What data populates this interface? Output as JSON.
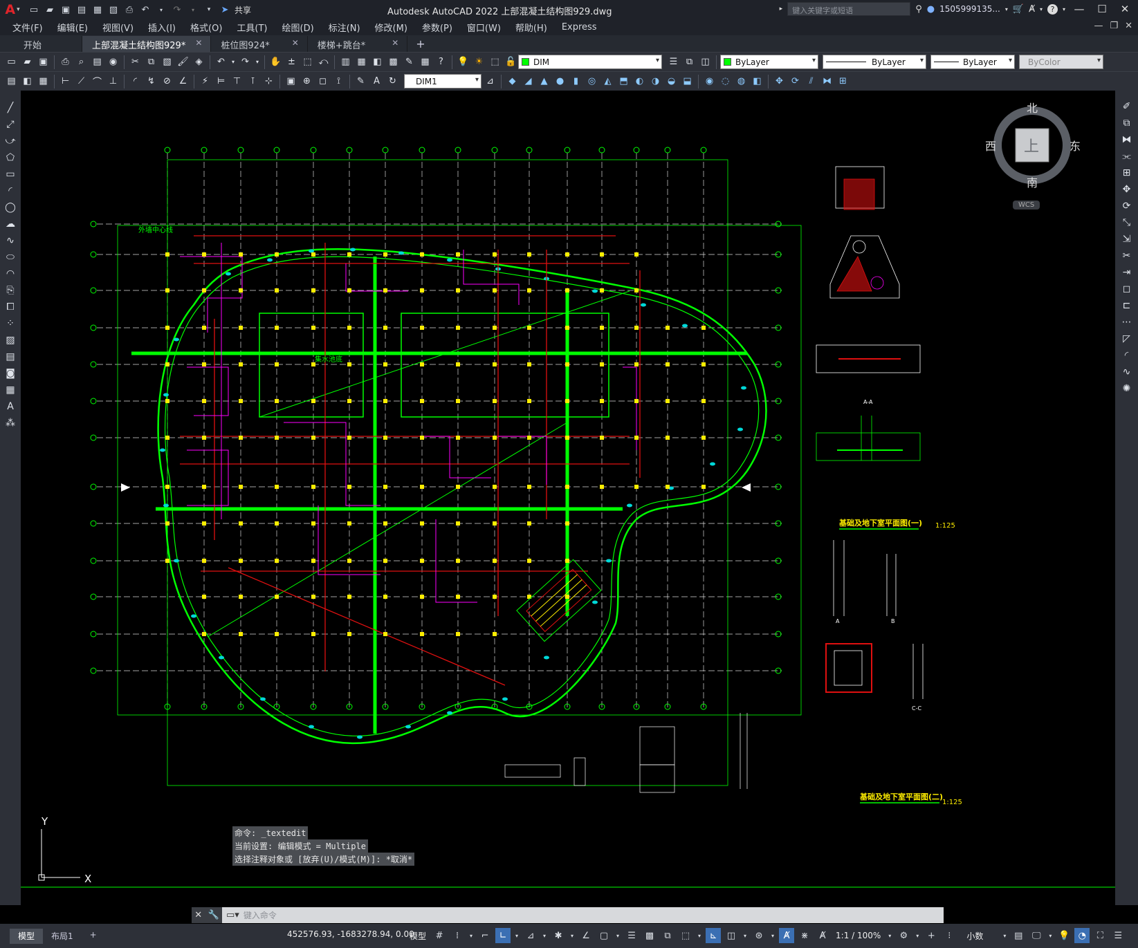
{
  "app": {
    "logo": "A",
    "title": "Autodesk AutoCAD 2022    上部混凝土结构图929.dwg",
    "share_label": "共享",
    "search_placeholder": "键入关键字或短语",
    "user": "1505999135...",
    "help": "?"
  },
  "menu": [
    "文件(F)",
    "编辑(E)",
    "视图(V)",
    "插入(I)",
    "格式(O)",
    "工具(T)",
    "绘图(D)",
    "标注(N)",
    "修改(M)",
    "参数(P)",
    "窗口(W)",
    "帮助(H)",
    "Express"
  ],
  "tabs": [
    {
      "label": "开始",
      "active": false,
      "closable": false
    },
    {
      "label": "上部混凝土结构图929*",
      "active": true,
      "closable": true
    },
    {
      "label": "桩位图924*",
      "active": false,
      "closable": true
    },
    {
      "label": "楼梯+跳台*",
      "active": false,
      "closable": true
    }
  ],
  "toolbar": {
    "layer": "DIM",
    "color": "ByLayer",
    "linetype": "ByLayer",
    "lineweight": "ByLayer",
    "plotstyle": "ByColor",
    "dimstyle": "DIM1"
  },
  "viewcube": {
    "north": "北",
    "south": "南",
    "east": "东",
    "west": "西",
    "top": "上",
    "wcs": "WCS"
  },
  "drawing": {
    "title1": "基础及地下室平面图(一)",
    "scale1": "1:125",
    "title2": "基础及地下室平面图(二)",
    "scale2": "1:125",
    "label_pool": "外墙中心线",
    "label_mid": "集水池底",
    "section_a": "A",
    "section_b": "B",
    "section_aa": "A-A",
    "section_cc": "C-C"
  },
  "ucs": {
    "y": "Y",
    "x": "X"
  },
  "command": {
    "history": [
      "命令: _textedit",
      "当前设置: 编辑模式 = Multiple",
      "选择注释对象或 [放弃(U)/模式(M)]: *取消*"
    ],
    "placeholder": "键入命令"
  },
  "status": {
    "layouts": [
      "模型",
      "布局1"
    ],
    "coords": "452576.93, -1683278.94, 0.00",
    "model": "模型",
    "scale": "1:1 / 100%",
    "units": "小数"
  },
  "colors": {
    "accent": "#3b6fb3",
    "axis": "#00d000",
    "beam": "#e01010",
    "column": "#ffee00",
    "wall": "#00ff00"
  }
}
